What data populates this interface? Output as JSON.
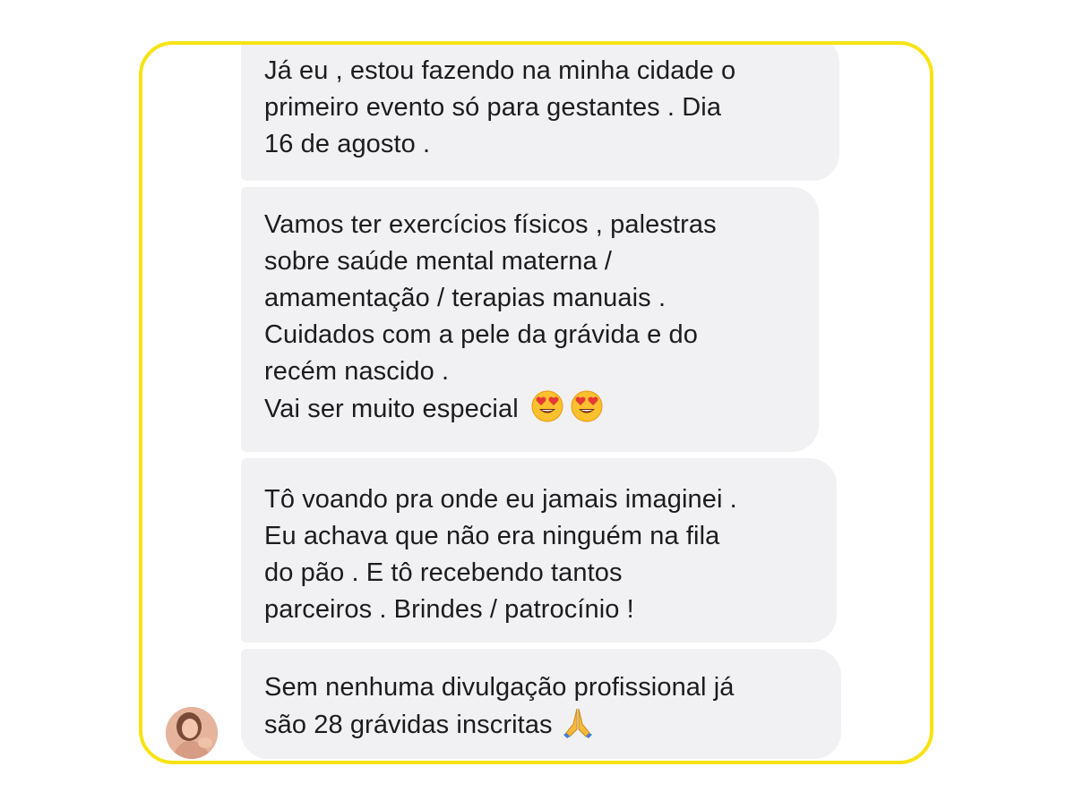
{
  "messages": [
    {
      "lines": [
        "Já eu , estou fazendo na minha cidade o",
        "primeiro evento só para gestantes . Dia",
        "16 de agosto ."
      ]
    },
    {
      "lines": [
        "Vamos ter exercícios físicos , palestras",
        "sobre saúde mental materna /",
        "amamentação / terapias manuais .",
        "Cuidados com a pele da grávida e do",
        "recém nascido .",
        "Vai ser muito especial"
      ],
      "emoji": [
        "heart-eyes-emoji",
        "heart-eyes-emoji"
      ]
    },
    {
      "lines": [
        "Tô voando pra onde eu jamais imaginei .",
        "Eu achava que não era ninguém na fila",
        "do pão . E tô recebendo tantos",
        "parceiros . Brindes / patrocínio !"
      ]
    },
    {
      "lines": [
        "Sem nenhuma divulgação profissional já",
        "são 28 grávidas inscritas"
      ],
      "emoji": [
        "folded-hands-emoji"
      ]
    }
  ],
  "colors": {
    "frame_border": "#f7e313",
    "bubble_bg": "#f1f1f3",
    "text": "#1c1c1e"
  },
  "icons": {
    "avatar": "sender-avatar"
  }
}
